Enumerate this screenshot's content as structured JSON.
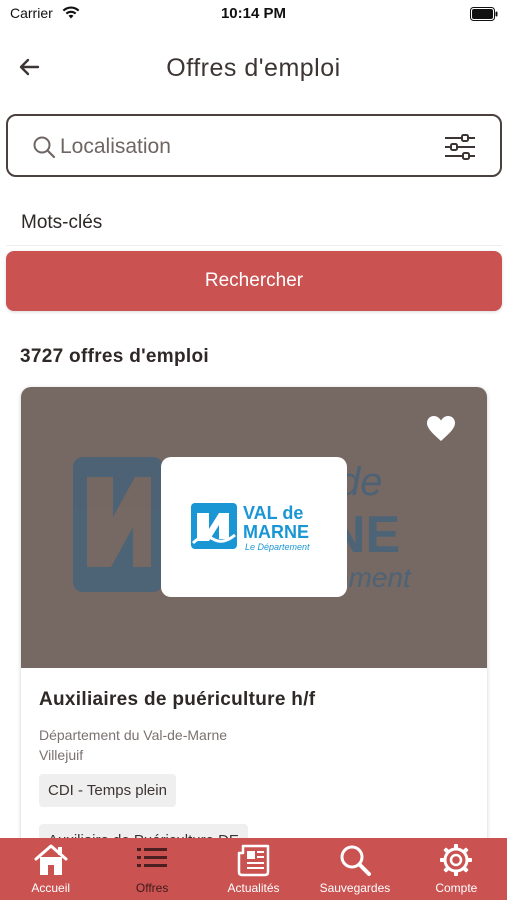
{
  "status_bar": {
    "carrier": "Carrier",
    "time": "10:14 PM",
    "icons": [
      "wifi-icon",
      "battery-icon"
    ]
  },
  "nav": {
    "title": "Offres d'emploi",
    "back_icon": "arrow-left-icon"
  },
  "search": {
    "placeholder": "Localisation",
    "icons": [
      "search-icon",
      "filter-sliders-icon"
    ]
  },
  "keywords": {
    "label": "Mots-clés"
  },
  "search_button": {
    "label": "Rechercher"
  },
  "results": {
    "count_text": "3727 offres d'emploi"
  },
  "job_card": {
    "title": "Auxiliaires de puériculture h/f",
    "employer": "Département du Val-de-Marne",
    "location": "Villejuif",
    "tags": [
      "CDI - Temps plein",
      "Auxiliaire de Puériculture DE"
    ],
    "logo_lines": [
      "VAL de",
      "MARNE",
      "Le Département"
    ],
    "favorite_icon": "heart-icon"
  },
  "tab_bar": {
    "items": [
      {
        "label": "Accueil",
        "icon": "home-icon"
      },
      {
        "label": "Offres",
        "icon": "list-icon"
      },
      {
        "label": "Actualités",
        "icon": "newspaper-icon"
      },
      {
        "label": "Sauvegardes",
        "icon": "search-icon"
      },
      {
        "label": "Compte",
        "icon": "gear-icon"
      }
    ]
  },
  "colors": {
    "accent": "#ca5352",
    "text": "#3d3533",
    "banner": "#766863",
    "logo_blue": "#1a96d4"
  }
}
